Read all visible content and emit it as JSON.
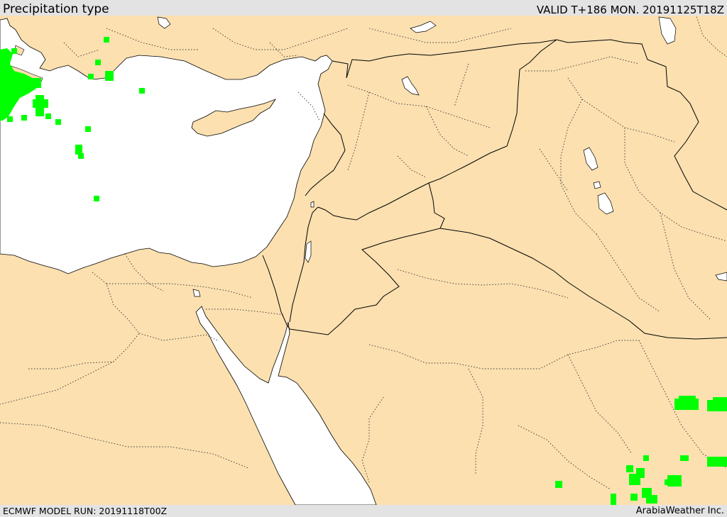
{
  "header": {
    "title": "Precipitation type",
    "valid": "VALID T+186 MON. 20191125T18Z"
  },
  "footer": {
    "model_run": "ECMWF MODEL RUN: 20191118T00Z",
    "credit": "ArabiaWeather Inc."
  },
  "colors": {
    "land": "#fce0b0",
    "water": "#ffffff",
    "rain": "#00ff00",
    "border": "#000000",
    "frame": "#e3e3e3"
  }
}
